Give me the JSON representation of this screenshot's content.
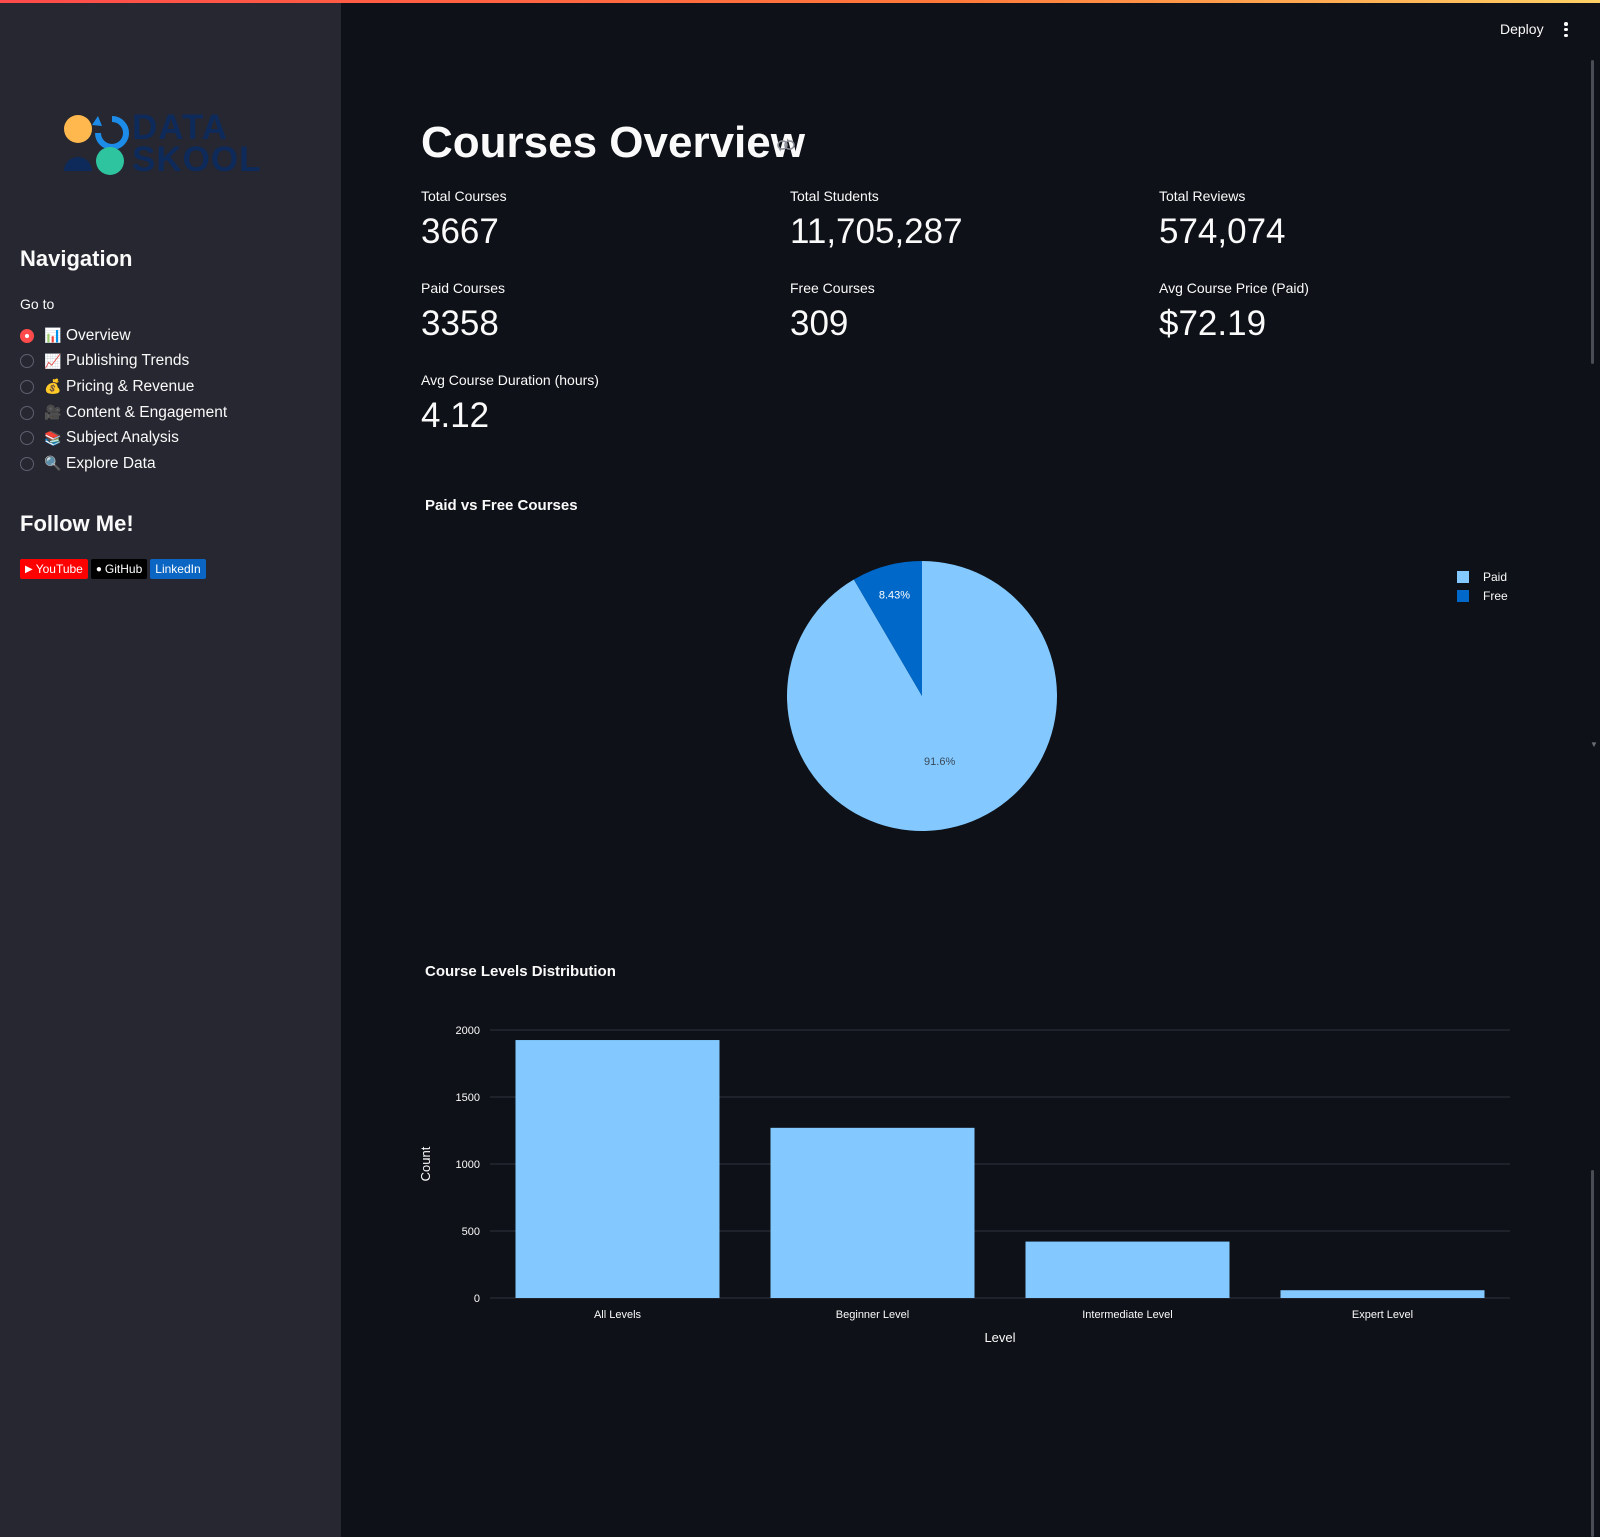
{
  "sidebar": {
    "logo_line1": "DATA",
    "logo_line2": "SKOOL",
    "nav_title": "Navigation",
    "goto_label": "Go to",
    "items": [
      {
        "label": "Overview",
        "emoji": "📊",
        "selected": true
      },
      {
        "label": "Publishing Trends",
        "emoji": "📈",
        "selected": false
      },
      {
        "label": "Pricing & Revenue",
        "emoji": "💰",
        "selected": false
      },
      {
        "label": "Content & Engagement",
        "emoji": "🎥",
        "selected": false
      },
      {
        "label": "Subject Analysis",
        "emoji": "📚",
        "selected": false
      },
      {
        "label": "Explore Data",
        "emoji": "🔍",
        "selected": false
      }
    ],
    "follow_title": "Follow Me!",
    "badges": {
      "youtube": "YouTube",
      "github": "GitHub",
      "linkedin": "LinkedIn"
    }
  },
  "header": {
    "deploy_label": "Deploy"
  },
  "main": {
    "title": "Courses Overview",
    "metrics": [
      {
        "label": "Total Courses",
        "value": "3667"
      },
      {
        "label": "Total Students",
        "value": "11,705,287"
      },
      {
        "label": "Total Reviews",
        "value": "574,074"
      },
      {
        "label": "Paid Courses",
        "value": "3358"
      },
      {
        "label": "Free Courses",
        "value": "309"
      },
      {
        "label": "Avg Course Price (Paid)",
        "value": "$72.19"
      },
      {
        "label": "Avg Course Duration (hours)",
        "value": "4.12"
      }
    ]
  },
  "colors": {
    "accent": "#ff4b4b",
    "paid": "#83c9ff",
    "free": "#0068c9",
    "bg": "#0e1117",
    "sidebar": "#262730"
  },
  "chart_data": [
    {
      "type": "pie",
      "title": "Paid vs Free Courses",
      "categories": [
        "Paid",
        "Free"
      ],
      "values": [
        3358,
        309
      ],
      "slice_labels": [
        "91.6%",
        "8.43%"
      ],
      "legend": "top-right"
    },
    {
      "type": "bar",
      "title": "Course Levels Distribution",
      "categories": [
        "All Levels",
        "Beginner Level",
        "Intermediate Level",
        "Expert Level"
      ],
      "values": [
        1925,
        1270,
        421,
        58
      ],
      "xlabel": "Level",
      "ylabel": "Count",
      "ylim": [
        0,
        2000
      ],
      "yticks": [
        0,
        500,
        1000,
        1500,
        2000
      ],
      "grid": true
    }
  ]
}
